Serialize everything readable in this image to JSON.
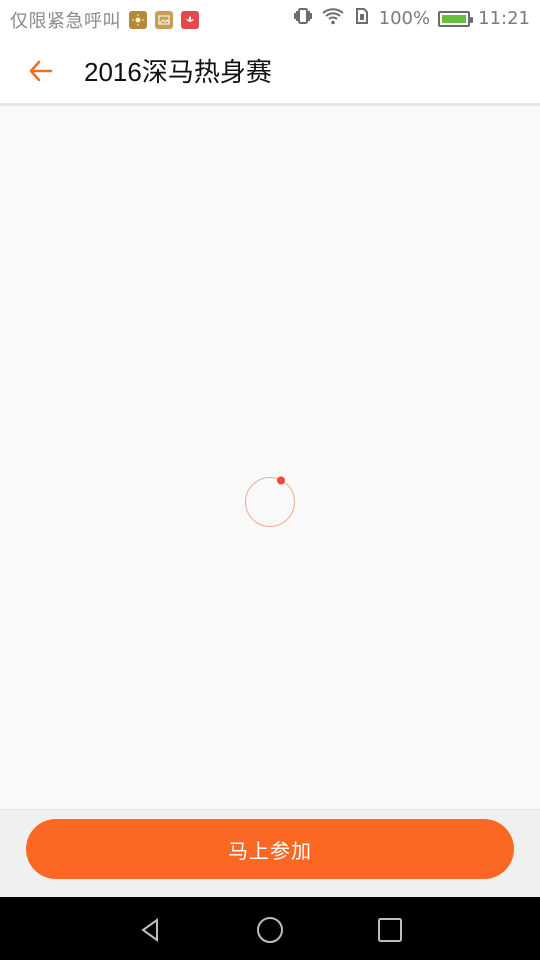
{
  "status_bar": {
    "carrier": "仅限紧急呼叫",
    "battery_percent": "100%",
    "time": "11:21",
    "icons": [
      "sun-app-icon",
      "gallery-app-icon",
      "huawei-app-icon",
      "vibrate-icon",
      "wifi-icon",
      "sim-icon",
      "battery-icon"
    ]
  },
  "header": {
    "title": "2016深马热身赛",
    "back_icon": "arrow-left-icon"
  },
  "content": {
    "loading_icon": "loading-spinner-icon"
  },
  "footer": {
    "join_label": "马上参加"
  },
  "nav_bar": {
    "icons": [
      "back-triangle-icon",
      "home-circle-icon",
      "recent-square-icon"
    ]
  },
  "colors": {
    "accent": "#fb6823",
    "back_arrow": "#f06e22",
    "spinner_ring": "#f4a98a",
    "spinner_dot": "#f04a32"
  }
}
